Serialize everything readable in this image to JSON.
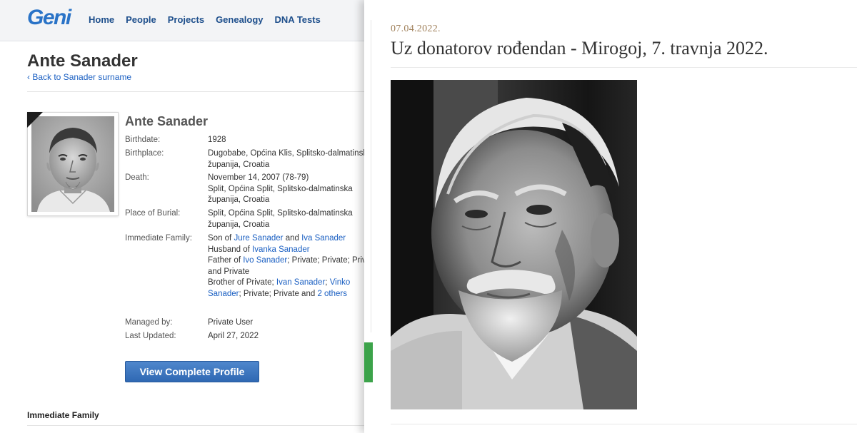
{
  "geni": {
    "logo": "Geni",
    "nav": [
      "Home",
      "People",
      "Projects",
      "Genealogy",
      "DNA Tests"
    ],
    "page_title": "Ante Sanader",
    "back_link": "‹ Back to Sanader surname",
    "profile_name": "Ante Sanader",
    "birthdate_label": "Birthdate:",
    "birthdate": "1928",
    "birthplace_label": "Birthplace:",
    "birthplace_1": "Dugobabe, Općina Klis, Splitsko-dalmatinska",
    "birthplace_2": "županija, Croatia",
    "death_label": "Death:",
    "death_1": "November 14, 2007 (78-79)",
    "death_2": "Split, Općina Split, Splitsko-dalmatinska",
    "death_3": "županija, Croatia",
    "burial_label": "Place of Burial:",
    "burial_1": "Split, Općina Split, Splitsko-dalmatinska",
    "burial_2": "županija, Croatia",
    "family_label": "Immediate Family:",
    "family": {
      "son_of": "Son of ",
      "father": "Jure Sanader",
      "and": " and ",
      "mother": "Iva Sanader",
      "husband_of": "Husband of ",
      "wife": "Ivanka Sanader",
      "father_of": "Father of ",
      "child": "Ivo Sanader",
      "father_of_rest": "; Private; Private; Private",
      "and_private": "and Private",
      "brother_of": "Brother of Private; ",
      "brother1": "Ivan Sanader",
      "sep": "; ",
      "brother2a": "Vinko",
      "brother2b": "Sanader",
      "brother_rest": "; Private; Private and ",
      "others": "2 others"
    },
    "managed_label": "Managed by:",
    "managed_by": "Private User",
    "updated_label": "Last Updated:",
    "last_updated": "April 27, 2022",
    "view_button": "View Complete Profile",
    "immediate_family_heading": "Immediate Family"
  },
  "article": {
    "date": "07.04.2022.",
    "title": "Uz donatorov rođendan - Mirogoj, 7. travnja 2022."
  },
  "colors": {
    "link": "#1a5fc2",
    "logo": "#2a73c7",
    "button": "#3a72bd",
    "article_date": "#a0805a",
    "green_tab": "#3ca34a"
  }
}
